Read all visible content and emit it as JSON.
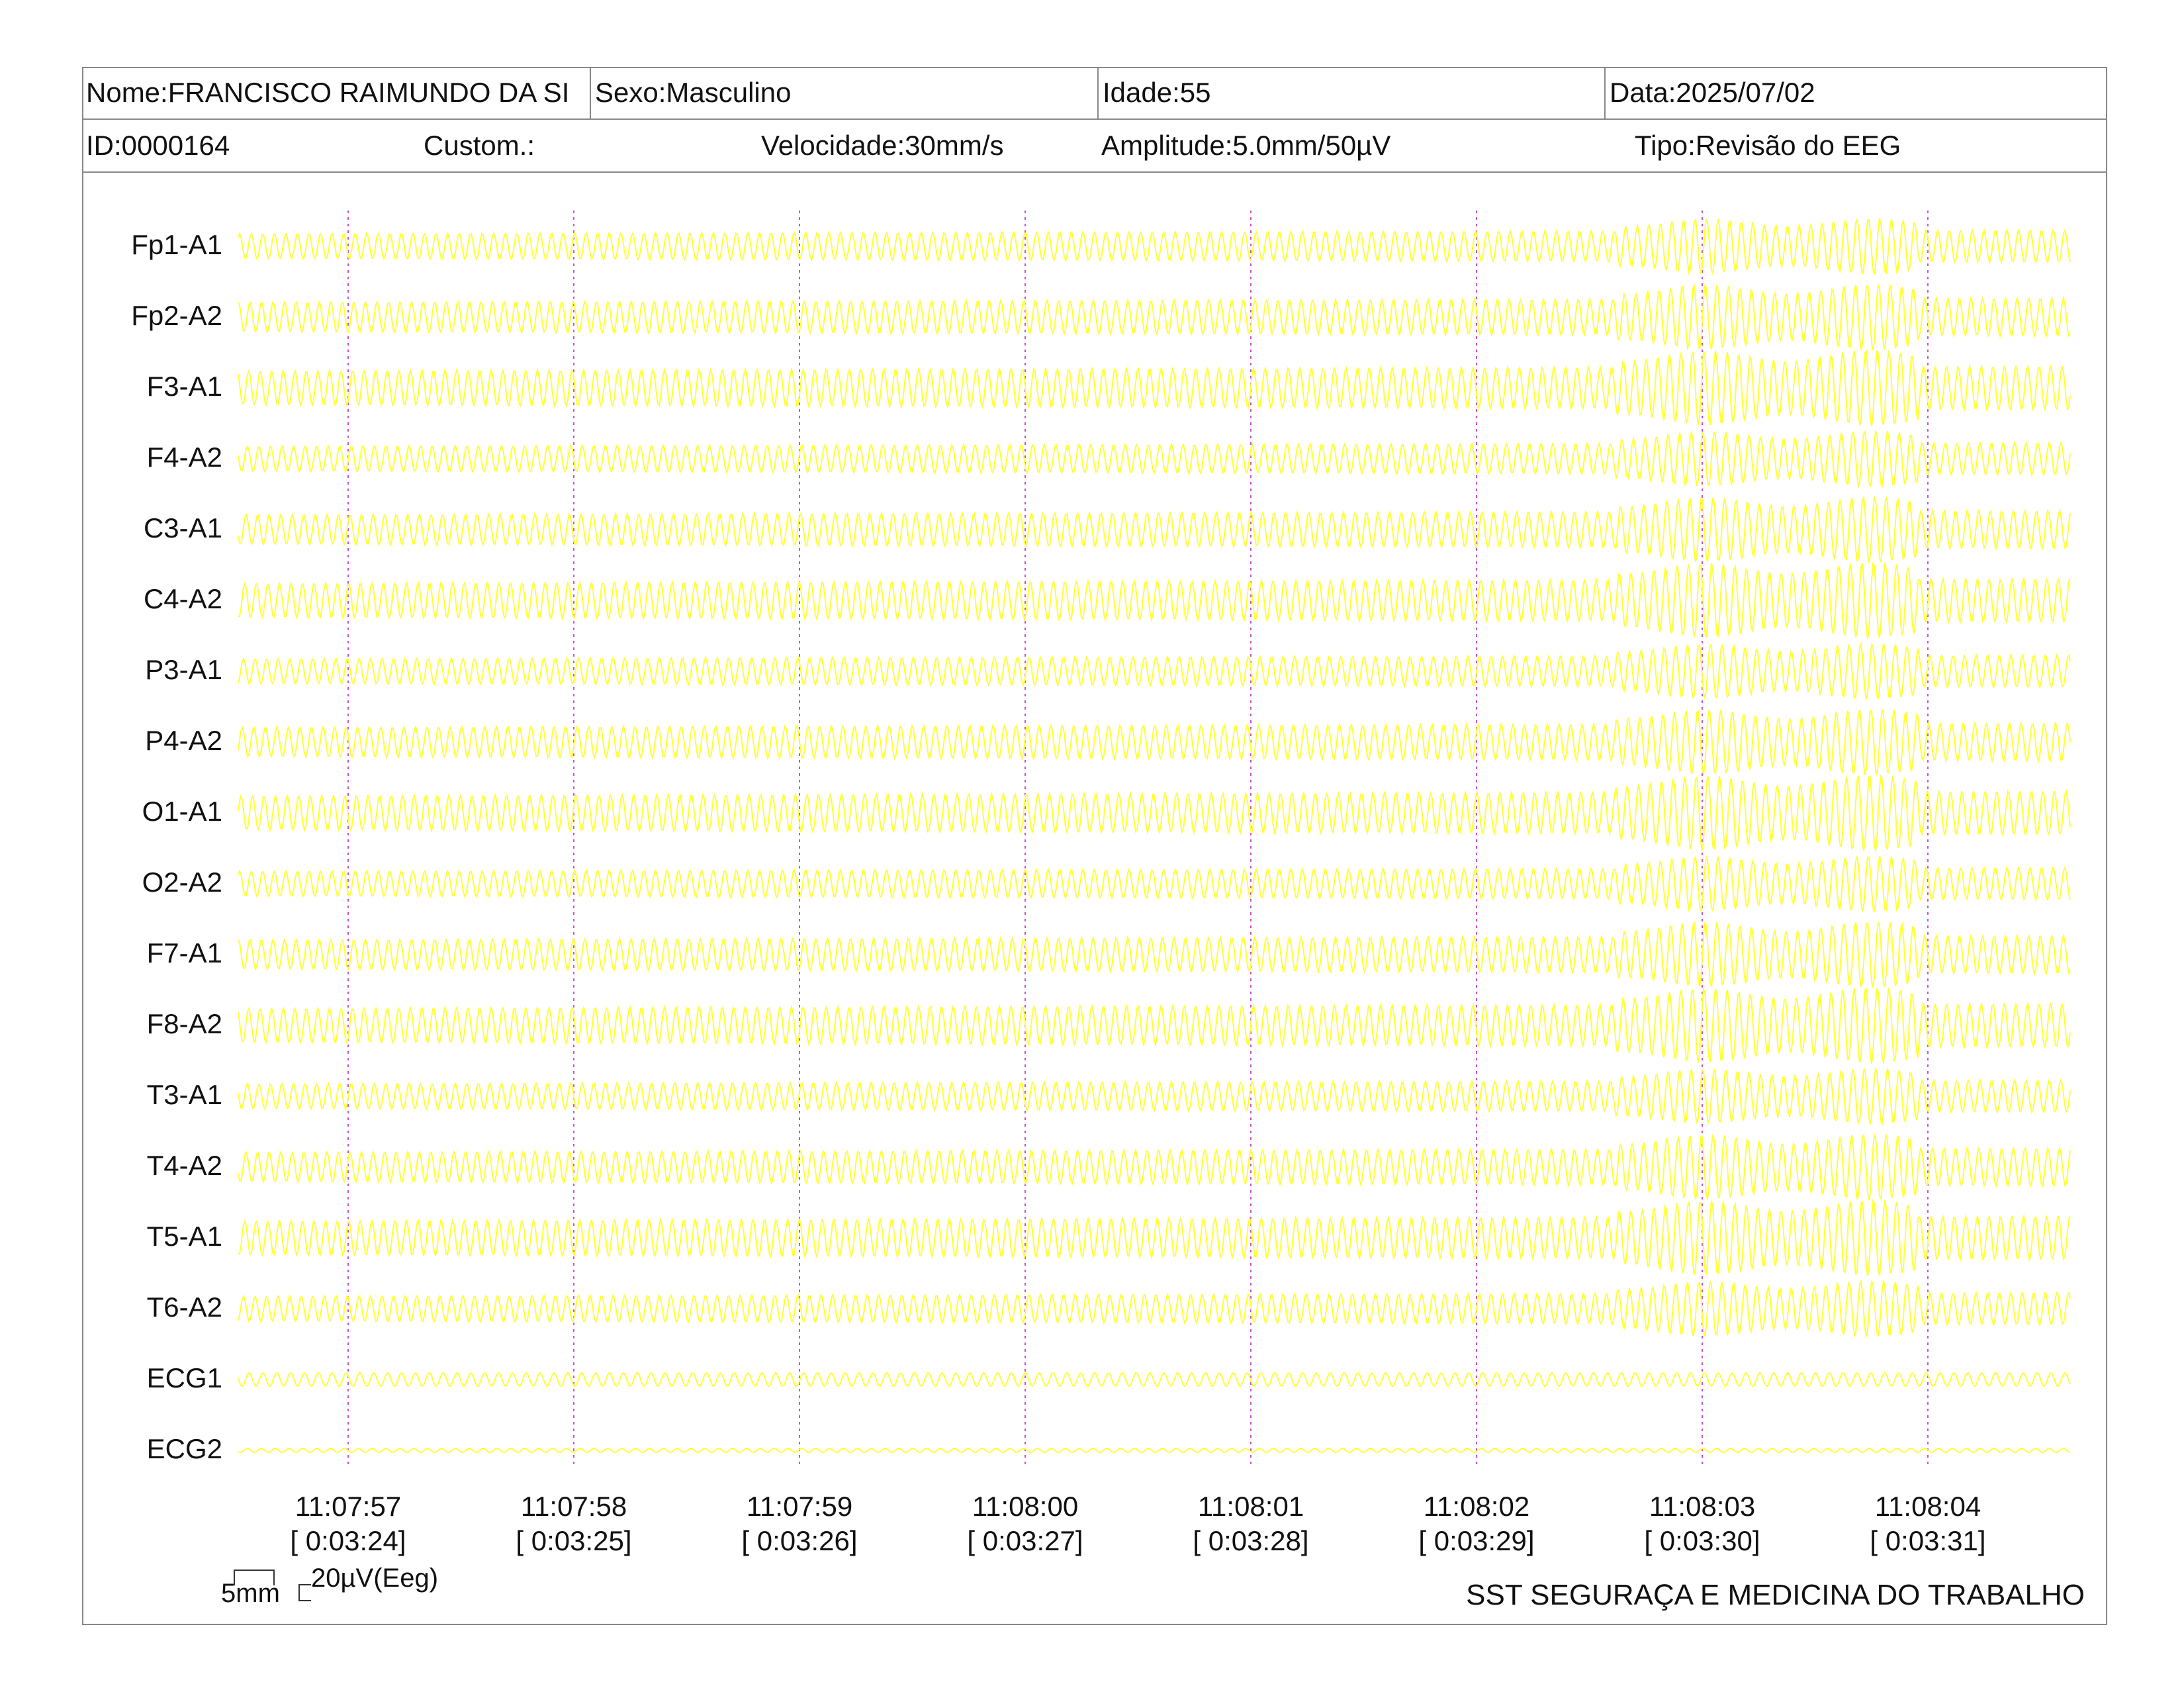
{
  "header": {
    "nome": "Nome:FRANCISCO RAIMUNDO DA SI",
    "sexo": "Sexo:Masculino",
    "idade": "Idade:55",
    "data": "Data:2025/07/02",
    "id": "ID:0000164",
    "custom": "Custom.:",
    "velocidade": "Velocidade:30mm/s",
    "amplitude": "Amplitude:5.0mm/50µV",
    "tipo": "Tipo:Revisão do EEG"
  },
  "channels": [
    "Fp1-A1",
    "Fp2-A2",
    "F3-A1",
    "F4-A2",
    "C3-A1",
    "C4-A2",
    "P3-A1",
    "P4-A2",
    "O1-A1",
    "O2-A2",
    "F7-A1",
    "F8-A2",
    "T3-A1",
    "T4-A2",
    "T5-A1",
    "T6-A2",
    "ECG1",
    "ECG2"
  ],
  "time_marks": [
    {
      "clock": "11:07:57",
      "elapsed": "[ 0:03:24]"
    },
    {
      "clock": "11:07:58",
      "elapsed": "[ 0:03:25]"
    },
    {
      "clock": "11:07:59",
      "elapsed": "[ 0:03:26]"
    },
    {
      "clock": "11:08:00",
      "elapsed": "[ 0:03:27]"
    },
    {
      "clock": "11:08:01",
      "elapsed": "[ 0:03:28]"
    },
    {
      "clock": "11:08:02",
      "elapsed": "[ 0:03:29]"
    },
    {
      "clock": "11:08:03",
      "elapsed": "[ 0:03:30]"
    },
    {
      "clock": "11:08:04",
      "elapsed": "[ 0:03:31]"
    }
  ],
  "scale": {
    "time": "5mm",
    "amplitude": "20µV(Eeg)"
  },
  "footer": "SST SEGURAÇA E MEDICINA DO TRABALHO",
  "colors": {
    "trace": "#ffff33",
    "marker": "#d050d0",
    "border": "#888888"
  }
}
